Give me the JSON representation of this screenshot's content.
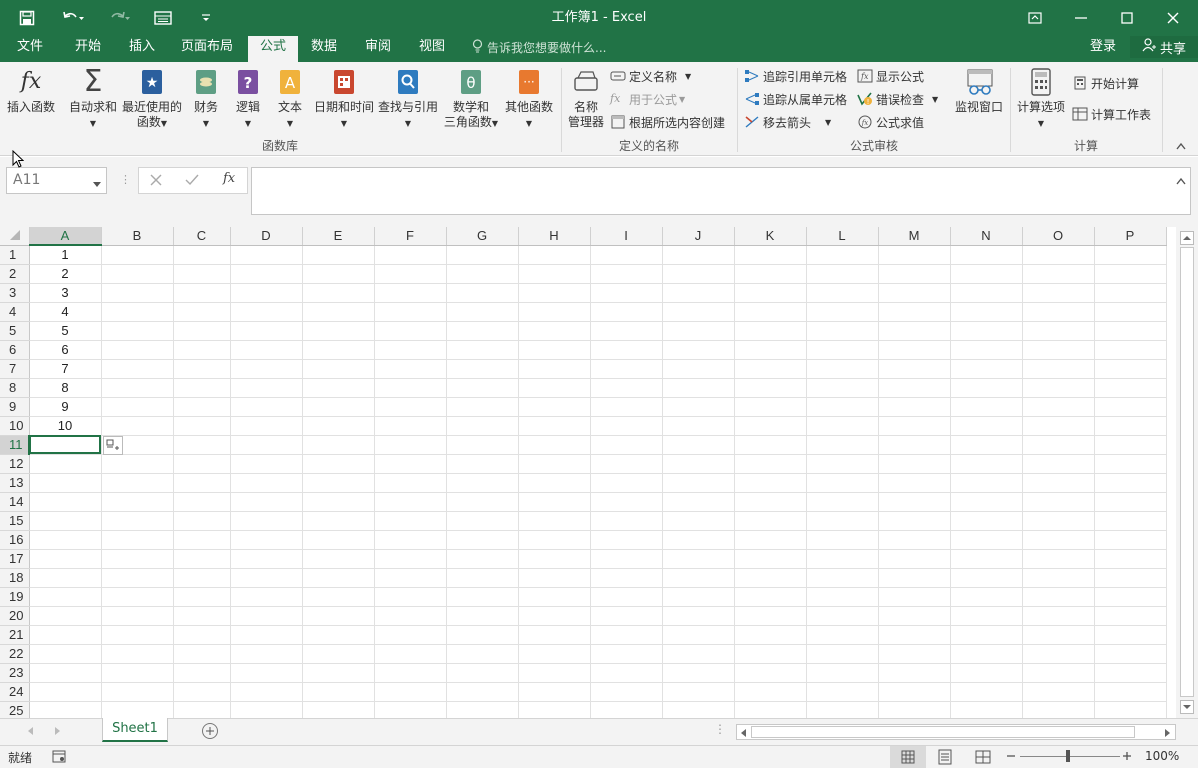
{
  "window": {
    "title": "工作簿1 - Excel"
  },
  "menu": {
    "tabs": [
      "文件",
      "开始",
      "插入",
      "页面布局",
      "公式",
      "数据",
      "审阅",
      "视图"
    ],
    "active": "公式",
    "tell_me": "告诉我您想要做什么...",
    "login": "登录",
    "share": "共享"
  },
  "ribbon": {
    "function_library": {
      "label": "函数库",
      "insert_function": "插入函数",
      "autosum": "自动求和",
      "recent_line1": "最近使用的",
      "recent_line2": "函数",
      "financial": "财务",
      "logical": "逻辑",
      "text": "文本",
      "datetime": "日期和时间",
      "lookup": "查找与引用",
      "math_line1": "数学和",
      "math_line2": "三角函数",
      "more": "其他函数"
    },
    "defined_names": {
      "label": "定义的名称",
      "name_manager_line1": "名称",
      "name_manager_line2": "管理器",
      "define_name": "定义名称",
      "use_in_formula": "用于公式",
      "create_from_selection": "根据所选内容创建"
    },
    "auditing": {
      "label": "公式审核",
      "trace_precedents": "追踪引用单元格",
      "trace_dependents": "追踪从属单元格",
      "remove_arrows": "移去箭头",
      "show_formulas": "显示公式",
      "error_checking": "错误检查",
      "evaluate_formula": "公式求值",
      "watch_window": "监视窗口"
    },
    "calculation": {
      "label": "计算",
      "calc_options": "计算选项",
      "calc_now": "开始计算",
      "calc_sheet": "计算工作表"
    }
  },
  "formula_bar": {
    "name_box": "A11",
    "fx": "fx",
    "value": ""
  },
  "grid": {
    "columns": [
      "A",
      "B",
      "C",
      "D",
      "E",
      "F",
      "G",
      "H",
      "I",
      "J",
      "K",
      "L",
      "M",
      "N",
      "O",
      "P"
    ],
    "rows": [
      "1",
      "2",
      "3",
      "4",
      "5",
      "6",
      "7",
      "8",
      "9",
      "10",
      "11",
      "12",
      "13",
      "14",
      "15",
      "16",
      "17",
      "18",
      "19",
      "20",
      "21",
      "22",
      "23",
      "24",
      "25"
    ],
    "colA_values": [
      "1",
      "2",
      "3",
      "4",
      "5",
      "6",
      "7",
      "8",
      "9",
      "10"
    ],
    "selected_cell": "A11"
  },
  "sheets": {
    "tabs": [
      "Sheet1"
    ]
  },
  "status": {
    "ready": "就绪",
    "zoom": "100%"
  },
  "colors": {
    "brand": "#217346",
    "ribbon_bg": "#f3f3f3"
  }
}
